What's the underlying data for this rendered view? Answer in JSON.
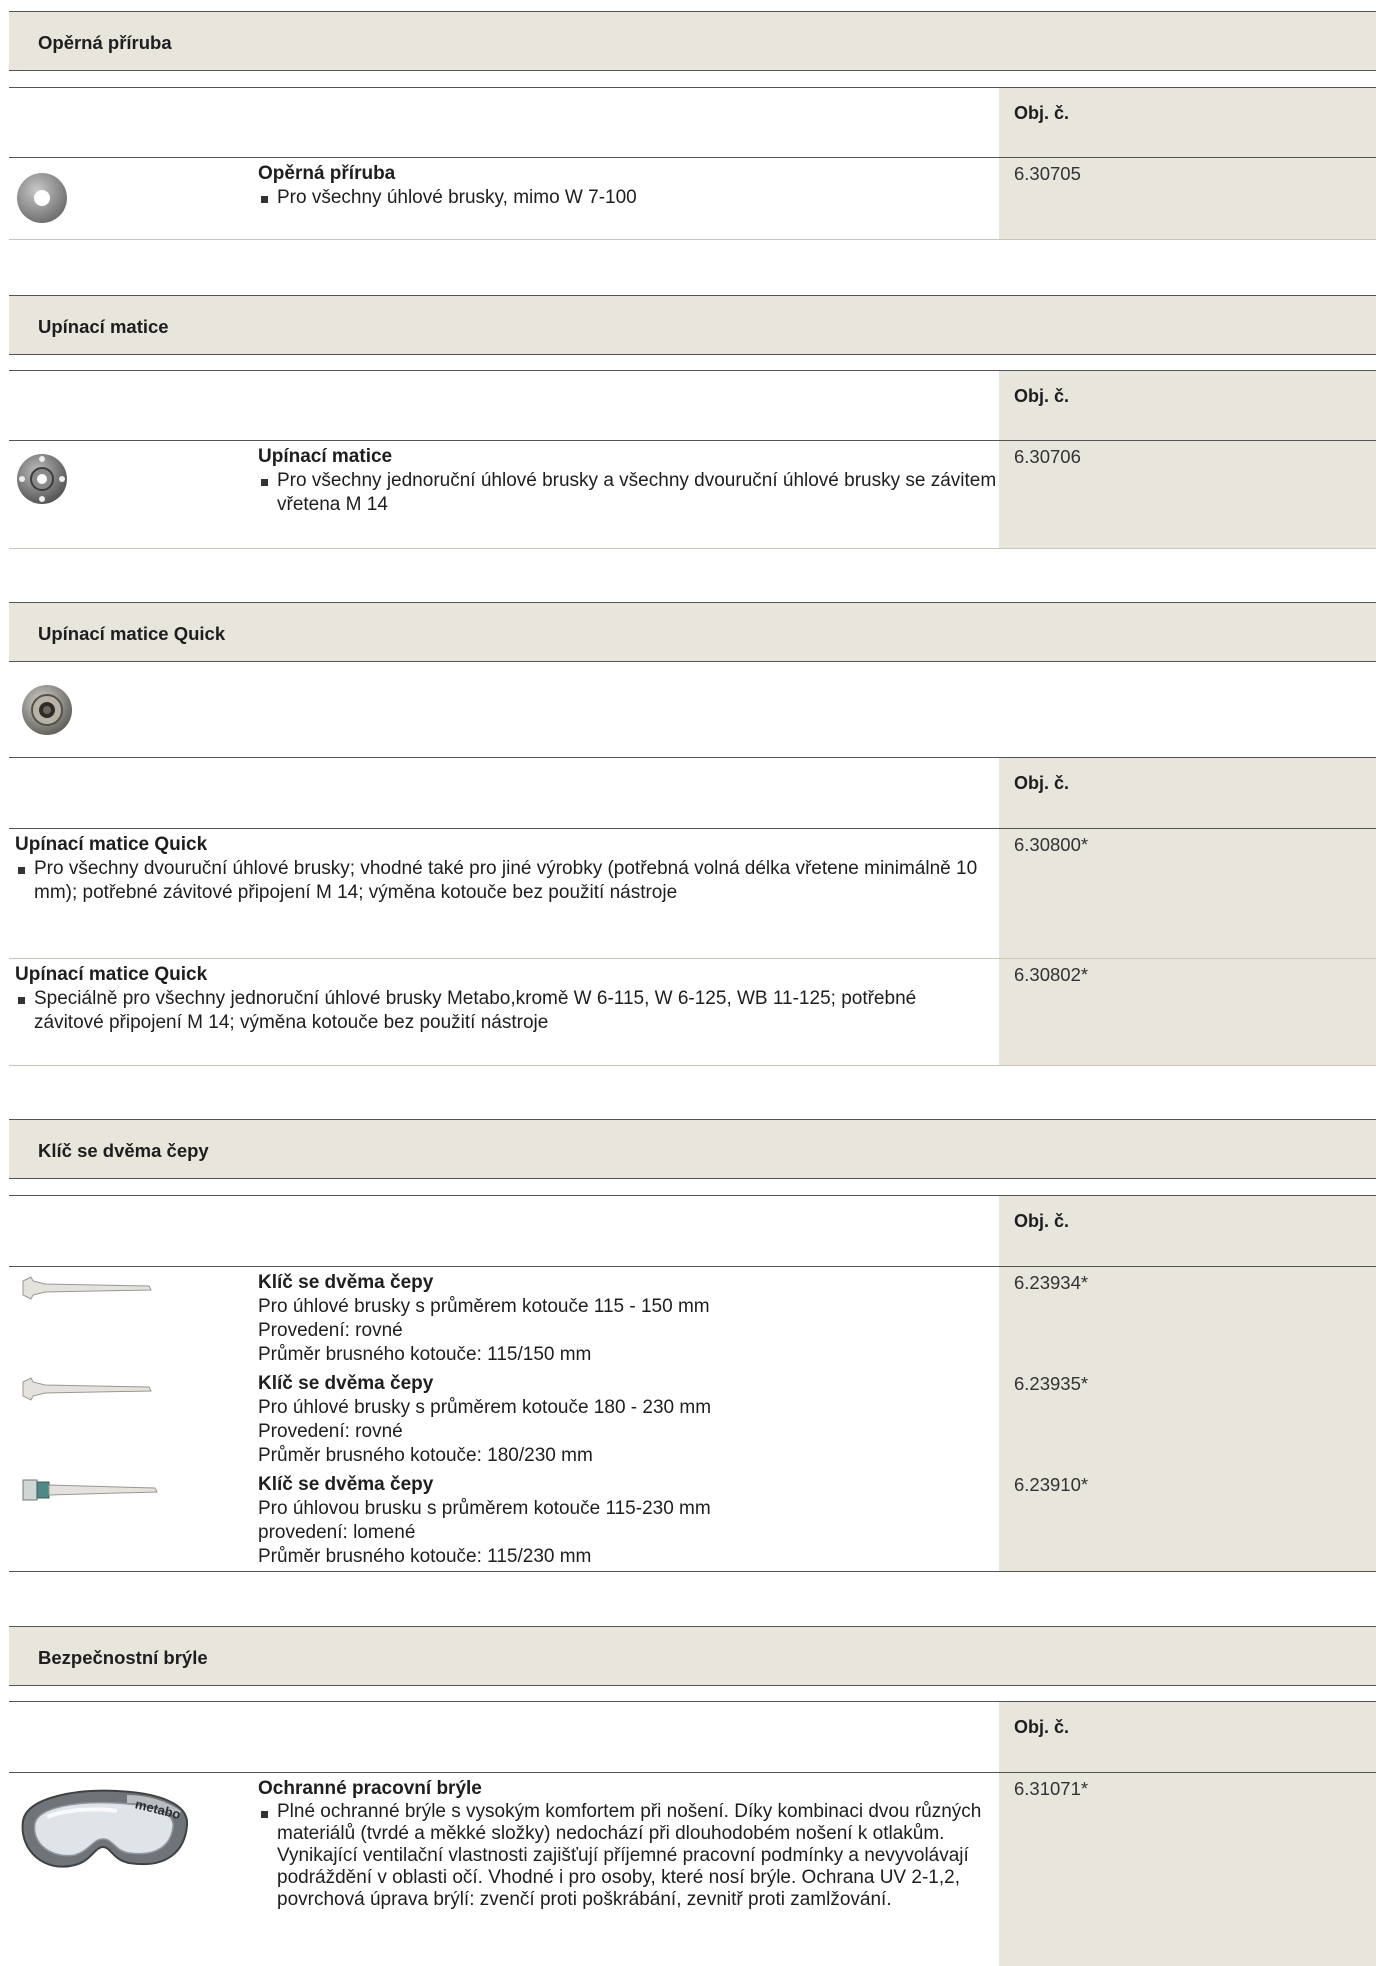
{
  "obj_header": "Obj. č.",
  "sections": [
    {
      "title": "Opěrná příruba",
      "rows": [
        {
          "title": "Opěrná příruba",
          "bullet": "Pro všechny úhlové brusky, mimo W 7-100",
          "number": "6.30705",
          "icon": "flange-icon"
        }
      ]
    },
    {
      "title": "Upínací matice",
      "rows": [
        {
          "title": "Upínací matice",
          "bullet": "Pro všechny jednoruční úhlové brusky a všechny dvouruční úhlové brusky se závitem vřetena M 14",
          "number": "6.30706",
          "icon": "clamping-nut-icon"
        }
      ]
    },
    {
      "title": "Upínací matice Quick",
      "rows": [
        {
          "title": "Upínací matice Quick",
          "bullet": "Pro všechny dvouruční úhlové brusky; vhodné také pro jiné výrobky (potřebná volná délka vřetene minimálně 10 mm); potřebné závitové připojení M 14; výměna kotouče bez použití nástroje",
          "number": "6.30800*"
        },
        {
          "title": "Upínací matice Quick",
          "bullet": "Speciálně pro všechny jednoruční úhlové brusky Metabo,kromě W 6-115, W 6-125, WB 11-125; potřebné závitové připojení M 14; výměna kotouče bez použití nástroje",
          "number": "6.30802*"
        }
      ]
    },
    {
      "title": "Klíč se dvěma čepy",
      "rows": [
        {
          "title": "Klíč se dvěma čepy",
          "lines": [
            "Pro úhlové brusky s průměrem kotouče 115 - 150 mm",
            "Provedení: rovné",
            "Průměr brusného kotouče: 115/150 mm"
          ],
          "number": "6.23934*",
          "icon": "pin-wrench-icon"
        },
        {
          "title": "Klíč se dvěma čepy",
          "lines": [
            "Pro úhlové brusky s průměrem kotouče 180 - 230 mm",
            "Provedení: rovné",
            "Průměr brusného kotouče: 180/230 mm"
          ],
          "number": "6.23935*",
          "icon": "pin-wrench-icon"
        },
        {
          "title": "Klíč se dvěma čepy",
          "lines": [
            "Pro úhlovou brusku s průměrem kotouče 115-230 mm",
            "provedení: lomené",
            "Průměr brusného kotouče: 115/230 mm"
          ],
          "number": "6.23910*",
          "icon": "angled-pin-wrench-icon"
        }
      ]
    },
    {
      "title": "Bezpečnostní brýle",
      "rows": [
        {
          "title": "Ochranné pracovní brýle",
          "bullet": "Plné ochranné brýle s vysokým komfortem při nošení. Díky kombinaci dvou různých materiálů (tvrdé a měkké složky) nedochází při dlouhodobém nošení k otlakům. Vynikající ventilační vlastnosti zajišťují příjemné pracovní podmínky a nevyvolávají podráždění v oblasti očí. Vhodné i pro osoby, které nosí brýle. Ochrana UV 2-1,2, povrchová úprava brýlí: zvenčí proti poškrábání, zevnitř proti zamlžování.",
          "number": "6.31071*",
          "icon": "safety-goggles-icon",
          "logo_text": "metabo"
        }
      ]
    }
  ]
}
